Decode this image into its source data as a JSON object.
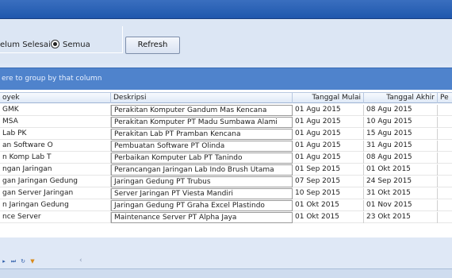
{
  "filter": {
    "radio_belum_label": "elum Selesai",
    "radio_semua_label": "Semua",
    "refresh_label": "Refresh"
  },
  "group_panel": {
    "hint": "ere to group by that column"
  },
  "columns": [
    "oyek",
    "Deskripsi",
    "Tanggal Mulai",
    "Tanggal Akhir",
    "Pe"
  ],
  "rows": [
    {
      "proyek": "GMK",
      "deskripsi": "Perakitan Komputer Gandum Mas Kencana",
      "mulai": "01 Agu 2015",
      "akhir": "08 Agu 2015"
    },
    {
      "proyek": "MSA",
      "deskripsi": "Perakitan Komputer PT Madu Sumbawa Alami",
      "mulai": "01 Agu 2015",
      "akhir": "10 Agu 2015"
    },
    {
      "proyek": "Lab PK",
      "deskripsi": "Perakitan Lab PT Pramban Kencana",
      "mulai": "01 Agu 2015",
      "akhir": "15 Agu 2015"
    },
    {
      "proyek": "an Software O",
      "deskripsi": "Pembuatan Software PT Olinda",
      "mulai": "01 Agu 2015",
      "akhir": "31 Agu 2015"
    },
    {
      "proyek": "n Komp Lab T",
      "deskripsi": "Perbaikan Komputer Lab PT Tanindo",
      "mulai": "01 Agu 2015",
      "akhir": "08 Agu 2015"
    },
    {
      "proyek": "ngan Jaringan",
      "deskripsi": "Perancangan Jaringan Lab Indo Brush Utama",
      "mulai": "01 Sep 2015",
      "akhir": "01 Okt 2015"
    },
    {
      "proyek": "gan Jaringan Gedung",
      "deskripsi": "Jaringan Gedung PT Trubus",
      "mulai": "07 Sep 2015",
      "akhir": "24 Sep 2015"
    },
    {
      "proyek": "gan Server Jaringan",
      "deskripsi": "Server Jaringan PT Viesta Mandiri",
      "mulai": "10 Sep 2015",
      "akhir": "31 Okt 2015"
    },
    {
      "proyek": "n Jaringan Gedung",
      "deskripsi": "Jaringan Gedung PT Graha Excel Plastindo",
      "mulai": "01 Okt 2015",
      "akhir": "01 Nov 2015"
    },
    {
      "proyek": "nce Server",
      "deskripsi": "Maintenance Server PT Alpha Jaya",
      "mulai": "01 Okt 2015",
      "akhir": "23 Okt 2015"
    }
  ],
  "colors": {
    "group_panel": "#4f83cc",
    "titlebar": "#1f57ad",
    "filter_bg": "#dce6f4"
  }
}
